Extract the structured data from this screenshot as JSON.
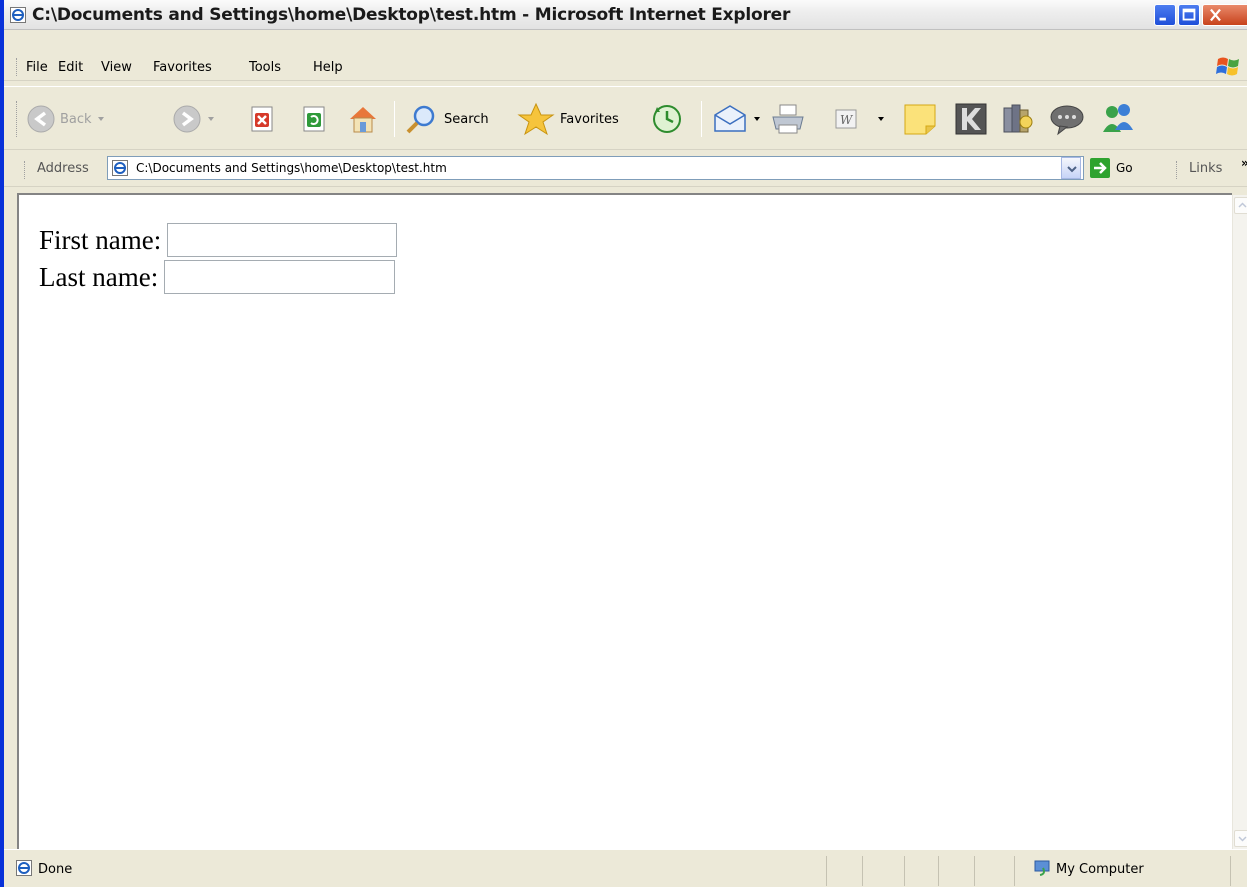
{
  "window": {
    "title": "C:\\Documents and Settings\\home\\Desktop\\test.htm - Microsoft Internet Explorer",
    "accent": "#0831d9"
  },
  "menu": {
    "items": [
      {
        "label": "File"
      },
      {
        "label": "Edit"
      },
      {
        "label": "View"
      },
      {
        "label": "Favorites"
      },
      {
        "label": "Tools"
      },
      {
        "label": "Help"
      }
    ]
  },
  "toolbar": {
    "back_label": "Back",
    "search_label": "Search",
    "favorites_label": "Favorites"
  },
  "address": {
    "label": "Address",
    "url": "C:\\Documents and Settings\\home\\Desktop\\test.htm",
    "go_label": "Go",
    "links_label": "Links",
    "links_more": "»"
  },
  "form": {
    "first_name_label": "First name:",
    "first_name_value": "",
    "last_name_label": "Last name:",
    "last_name_value": ""
  },
  "status": {
    "text": "Done",
    "zone": "My Computer"
  }
}
